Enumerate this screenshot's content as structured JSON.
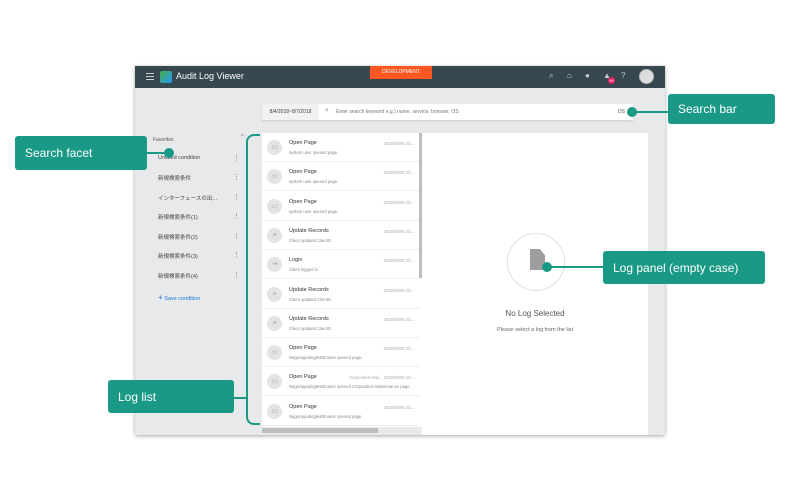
{
  "app": {
    "title": "Audit Log Viewer",
    "logo": "LS",
    "environment": "DEVELOPMENT",
    "notification_count": "90",
    "header_icons": [
      "search-icon",
      "inbox-icon",
      "chat-icon",
      "bell-icon",
      "help-icon",
      "avatar"
    ]
  },
  "search": {
    "date_range": "8/4/2018~8/7/2018",
    "placeholder": "Enter search keyword e.g.) name, service, browser, OS",
    "trailing": "OS"
  },
  "sidebar": {
    "heading": "Favorites",
    "items": [
      "Untitled condition",
      "新規検索条件",
      "インターフェースの出...",
      "新規検索条件(1)",
      "新規検索条件(2)",
      "新規検索条件(3)",
      "新規検索条件(4)"
    ],
    "save_label": "Save condition"
  },
  "logs": [
    {
      "title": "Open Page",
      "sub": "system user opened page.",
      "date": "2018/08/06 23:...",
      "icon": "monitor-icon",
      "service": ""
    },
    {
      "title": "Open Page",
      "sub": "system user opened page.",
      "date": "2018/08/06 23:...",
      "icon": "monitor-icon",
      "service": ""
    },
    {
      "title": "Open Page",
      "sub": "system user opened page.",
      "date": "2018/08/06 23:...",
      "icon": "monitor-icon",
      "service": ""
    },
    {
      "title": "Update Records",
      "sub": "Client updated ClientG.",
      "date": "2018/08/06 23:...",
      "icon": "database-icon",
      "service": ""
    },
    {
      "title": "Login",
      "sub": "Client logged in.",
      "date": "2018/08/06 23:...",
      "icon": "login-icon",
      "service": ""
    },
    {
      "title": "Update Records",
      "sub": "Client updated ClientG.",
      "date": "2018/08/06 23:...",
      "icon": "database-icon",
      "service": ""
    },
    {
      "title": "Update Records",
      "sub": "Client updated ClientG.",
      "date": "2018/08/06 23:...",
      "icon": "database-icon",
      "service": ""
    },
    {
      "title": "Open Page",
      "sub": "NagaAppadogtestEname opened page.",
      "date": "2018/08/06 23:...",
      "icon": "monitor-icon",
      "service": ""
    },
    {
      "title": "Open Page",
      "sub": "NagaAppadogtestEname opened Corporation Maintenance page.",
      "date": "2018/08/06 23:...",
      "icon": "monitor-icon",
      "service": "Corporation Mai..."
    },
    {
      "title": "Open Page",
      "sub": "NagaAppadogtestEname opened page.",
      "date": "2018/08/06 23:...",
      "icon": "monitor-icon",
      "service": ""
    }
  ],
  "panel": {
    "empty_title": "No Log Selected",
    "empty_hint": "Please select a log from the list",
    "icon": "document-icon"
  },
  "callouts": {
    "search_facet": "Search facet",
    "search_bar": "Search bar",
    "log_panel": "Log panel (empty case)",
    "log_list": "Log list"
  },
  "colors": {
    "header": "#37474f",
    "environment": "#ff5722",
    "callout": "#1a9a86",
    "badge": "#e91e63"
  }
}
